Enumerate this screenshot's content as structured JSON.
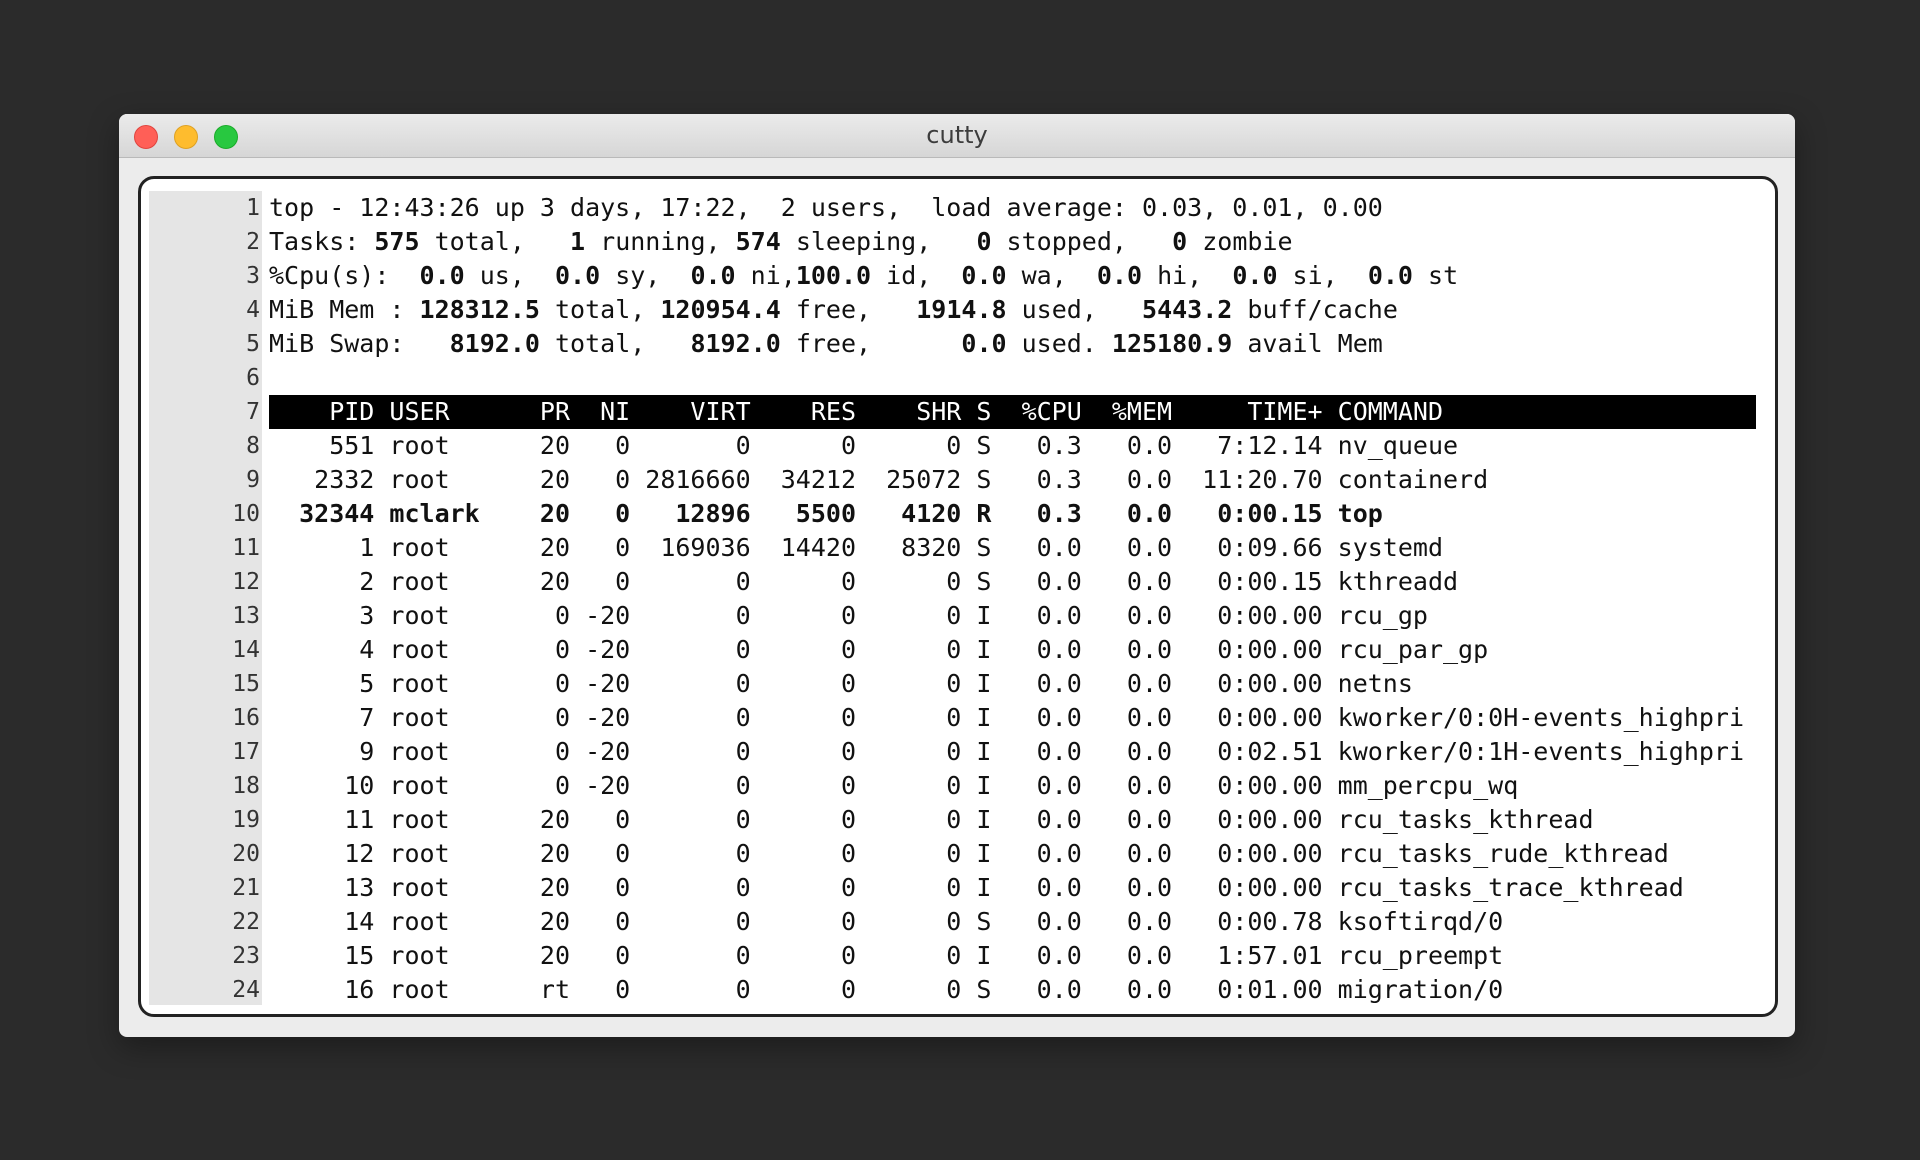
{
  "window": {
    "title": "cutty"
  },
  "summary": {
    "line1": "top - 12:43:26 up 3 days, 17:22,  2 users,  load average: 0.03, 0.01, 0.00",
    "tasks": {
      "prefix": "Tasks: ",
      "total": "575",
      "total_label": " total,   ",
      "running": "1",
      "running_label": " running, ",
      "sleeping": "574",
      "sleeping_label": " sleeping,   ",
      "stopped": "0",
      "stopped_label": " stopped,   ",
      "zombie": "0",
      "zombie_label": " zombie"
    },
    "cpu": {
      "prefix": "%Cpu(s):  ",
      "us": "0.0",
      "us_label": " us,  ",
      "sy": "0.0",
      "sy_label": " sy,  ",
      "ni": "0.0",
      "ni_label": " ni,",
      "id": "100.0",
      "id_label": " id,  ",
      "wa": "0.0",
      "wa_label": " wa,  ",
      "hi": "0.0",
      "hi_label": " hi,  ",
      "si": "0.0",
      "si_label": " si,  ",
      "st": "0.0",
      "st_label": " st"
    },
    "mem": {
      "prefix": "MiB Mem : ",
      "total": "128312.5",
      "total_label": " total, ",
      "free": "120954.4",
      "free_label": " free,   ",
      "used": "1914.8",
      "used_label": " used,   ",
      "buff": "5443.2",
      "buff_label": " buff/cache"
    },
    "swap": {
      "prefix": "MiB Swap:   ",
      "total": "8192.0",
      "total_label": " total,   ",
      "free": "8192.0",
      "free_label": " free,      ",
      "used": "0.0",
      "used_label": " used. ",
      "avail": "125180.9",
      "avail_label": " avail Mem"
    }
  },
  "table_header": "    PID USER      PR  NI    VIRT    RES    SHR S  %CPU  %MEM     TIME+ COMMAND",
  "processes": [
    "    551 root      20   0       0      0      0 S   0.3   0.0   7:12.14 nv_queue",
    "   2332 root      20   0 2816660  34212  25072 S   0.3   0.0  11:20.70 containerd",
    "  32344 mclark    20   0   12896   5500   4120 R   0.3   0.0   0:00.15 top",
    "      1 root      20   0  169036  14420   8320 S   0.0   0.0   0:09.66 systemd",
    "      2 root      20   0       0      0      0 S   0.0   0.0   0:00.15 kthreadd",
    "      3 root       0 -20       0      0      0 I   0.0   0.0   0:00.00 rcu_gp",
    "      4 root       0 -20       0      0      0 I   0.0   0.0   0:00.00 rcu_par_gp",
    "      5 root       0 -20       0      0      0 I   0.0   0.0   0:00.00 netns",
    "      7 root       0 -20       0      0      0 I   0.0   0.0   0:00.00 kworker/0:0H-events_highpri",
    "      9 root       0 -20       0      0      0 I   0.0   0.0   0:02.51 kworker/0:1H-events_highpri",
    "     10 root       0 -20       0      0      0 I   0.0   0.0   0:00.00 mm_percpu_wq",
    "     11 root      20   0       0      0      0 I   0.0   0.0   0:00.00 rcu_tasks_kthread",
    "     12 root      20   0       0      0      0 I   0.0   0.0   0:00.00 rcu_tasks_rude_kthread",
    "     13 root      20   0       0      0      0 I   0.0   0.0   0:00.00 rcu_tasks_trace_kthread",
    "     14 root      20   0       0      0      0 S   0.0   0.0   0:00.78 ksoftirqd/0",
    "     15 root      20   0       0      0      0 I   0.0   0.0   1:57.01 rcu_preempt",
    "     16 root      rt   0       0      0      0 S   0.0   0.0   0:01.00 migration/0"
  ],
  "line_numbers": [
    "1",
    "2",
    "3",
    "4",
    "5",
    "6",
    "7",
    "8",
    "9",
    "10",
    "11",
    "12",
    "13",
    "14",
    "15",
    "16",
    "17",
    "18",
    "19",
    "20",
    "21",
    "22",
    "23",
    "24"
  ]
}
